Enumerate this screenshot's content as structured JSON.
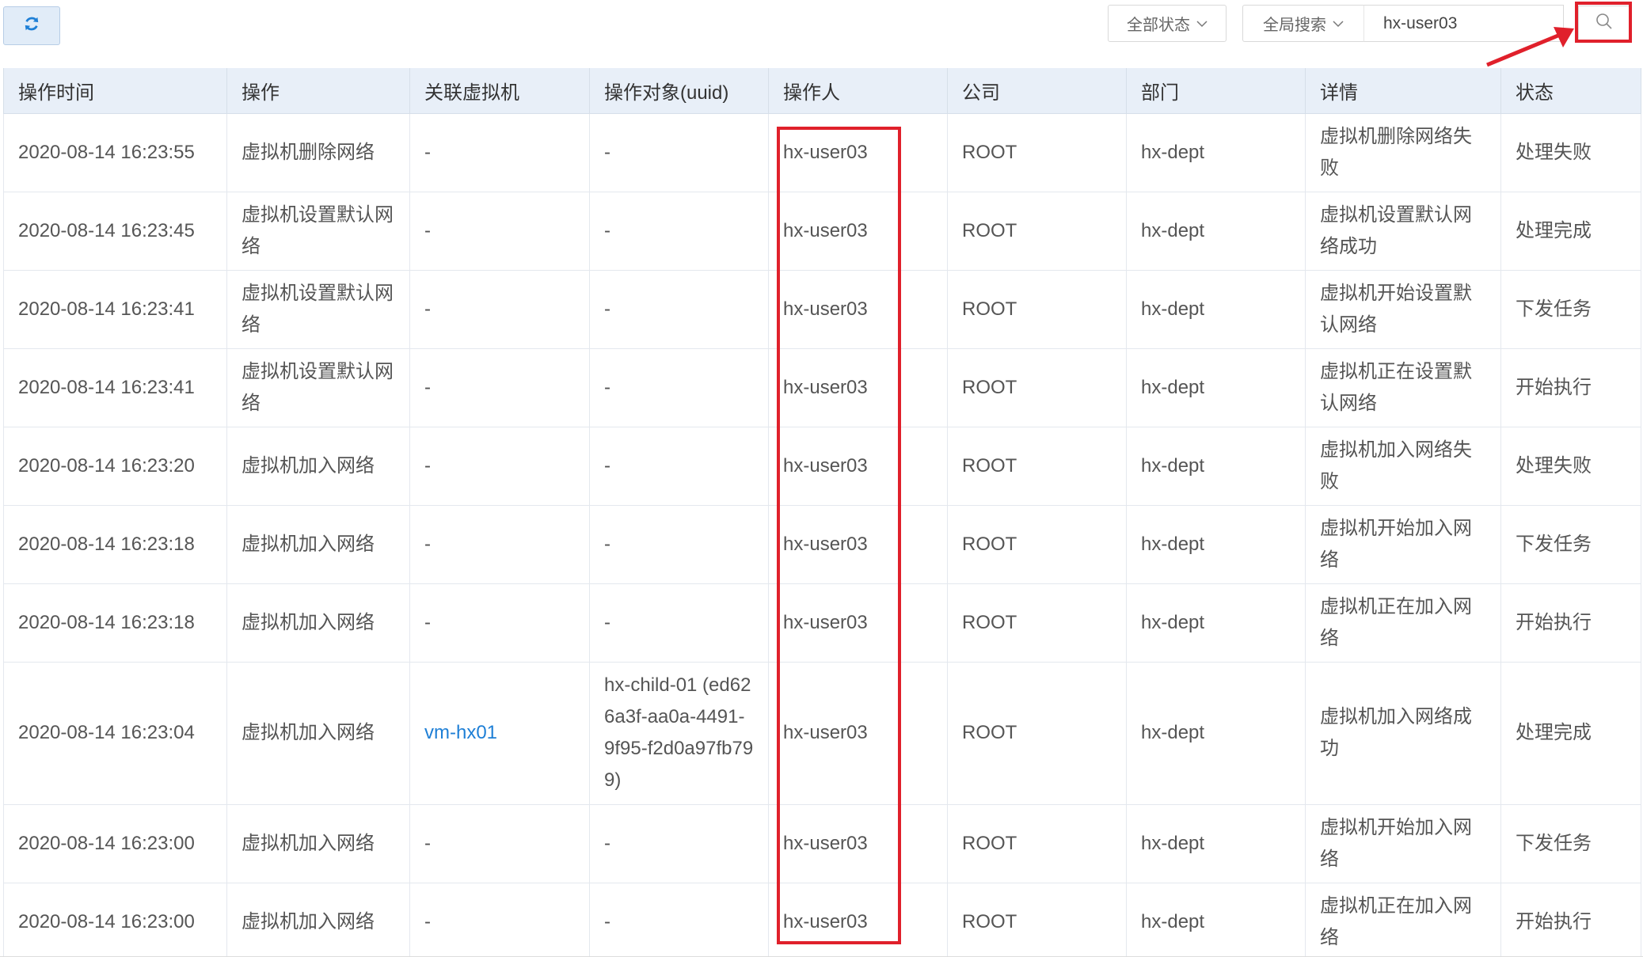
{
  "toolbar": {
    "refresh_icon": "refresh-icon",
    "status_filter": "全部状态",
    "search_scope": "全局搜索",
    "search_value": "hx-user03",
    "search_icon": "search-icon",
    "accent_color": "#1e7fd6",
    "highlight_color": "#e0202b"
  },
  "table": {
    "columns": [
      "操作时间",
      "操作",
      "关联虚拟机",
      "操作对象(uuid)",
      "操作人",
      "公司",
      "部门",
      "详情",
      "状态"
    ],
    "rows": [
      {
        "time": "2020-08-14 16:23:55",
        "action": "虚拟机删除网络",
        "vm": "-",
        "target": "-",
        "user": "hx-user03",
        "company": "ROOT",
        "dept": "hx-dept",
        "detail": "虚拟机删除网络失败",
        "status": "处理失败"
      },
      {
        "time": "2020-08-14 16:23:45",
        "action": "虚拟机设置默认网络",
        "vm": "-",
        "target": "-",
        "user": "hx-user03",
        "company": "ROOT",
        "dept": "hx-dept",
        "detail": "虚拟机设置默认网络成功",
        "status": "处理完成"
      },
      {
        "time": "2020-08-14 16:23:41",
        "action": "虚拟机设置默认网络",
        "vm": "-",
        "target": "-",
        "user": "hx-user03",
        "company": "ROOT",
        "dept": "hx-dept",
        "detail": "虚拟机开始设置默认网络",
        "status": "下发任务"
      },
      {
        "time": "2020-08-14 16:23:41",
        "action": "虚拟机设置默认网络",
        "vm": "-",
        "target": "-",
        "user": "hx-user03",
        "company": "ROOT",
        "dept": "hx-dept",
        "detail": "虚拟机正在设置默认网络",
        "status": "开始执行"
      },
      {
        "time": "2020-08-14 16:23:20",
        "action": "虚拟机加入网络",
        "vm": "-",
        "target": "-",
        "user": "hx-user03",
        "company": "ROOT",
        "dept": "hx-dept",
        "detail": "虚拟机加入网络失败",
        "status": "处理失败"
      },
      {
        "time": "2020-08-14 16:23:18",
        "action": "虚拟机加入网络",
        "vm": "-",
        "target": "-",
        "user": "hx-user03",
        "company": "ROOT",
        "dept": "hx-dept",
        "detail": "虚拟机开始加入网络",
        "status": "下发任务"
      },
      {
        "time": "2020-08-14 16:23:18",
        "action": "虚拟机加入网络",
        "vm": "-",
        "target": "-",
        "user": "hx-user03",
        "company": "ROOT",
        "dept": "hx-dept",
        "detail": "虚拟机正在加入网络",
        "status": "开始执行"
      },
      {
        "time": "2020-08-14 16:23:04",
        "action": "虚拟机加入网络",
        "vm": "vm-hx01",
        "target": "hx-child-01 (ed626a3f-aa0a-4491-9f95-f2d0a97fb799)",
        "user": "hx-user03",
        "company": "ROOT",
        "dept": "hx-dept",
        "detail": "虚拟机加入网络成功",
        "status": "处理完成"
      },
      {
        "time": "2020-08-14 16:23:00",
        "action": "虚拟机加入网络",
        "vm": "-",
        "target": "-",
        "user": "hx-user03",
        "company": "ROOT",
        "dept": "hx-dept",
        "detail": "虚拟机开始加入网络",
        "status": "下发任务"
      },
      {
        "time": "2020-08-14 16:23:00",
        "action": "虚拟机加入网络",
        "vm": "-",
        "target": "-",
        "user": "hx-user03",
        "company": "ROOT",
        "dept": "hx-dept",
        "detail": "虚拟机正在加入网络",
        "status": "开始执行"
      }
    ]
  }
}
